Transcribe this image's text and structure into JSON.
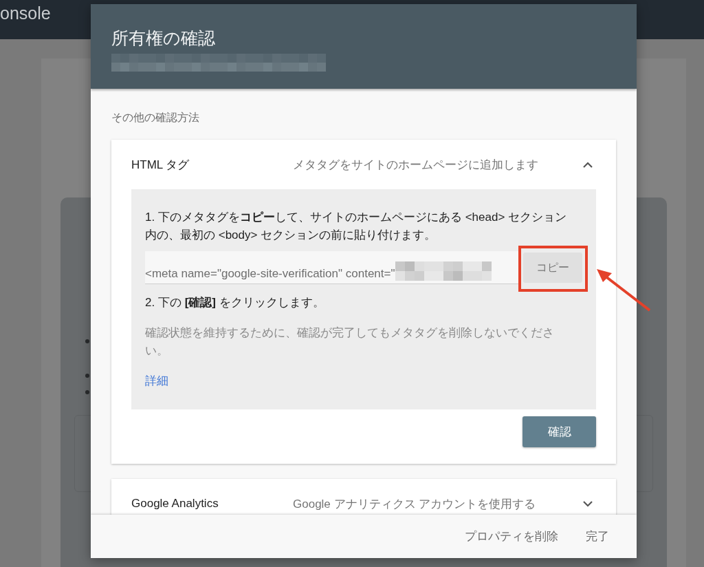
{
  "app_bar": {
    "title": "onsole"
  },
  "dialog": {
    "title": "所有権の確認",
    "section_label": "その他の確認方法",
    "methods": [
      {
        "title": "HTML タグ",
        "description": "メタタグをサイトのホームページに追加します",
        "expanded": true,
        "step_1": "1. 下のメタタグを**コピー**して、サイトのホームページにある <head> セクション内の、最初の <body> セクションの前に貼り付けます。",
        "meta_tag": "<meta name=\"google-site-verification\" content=\"",
        "copy_button": {
          "label": "コピー",
          "highlighted": true
        },
        "step_2": "2. 下の **[確認]** をクリックします。",
        "note": "確認状態を維持するために、確認が完了してもメタタグを削除しないでください。",
        "link": "詳細",
        "confirm_button": "確認"
      },
      {
        "title": "Google Analytics",
        "description": "Google アナリティクス アカウントを使用する",
        "expanded": false
      }
    ],
    "footer_buttons": [
      "プロパティを削除",
      "完了"
    ]
  }
}
